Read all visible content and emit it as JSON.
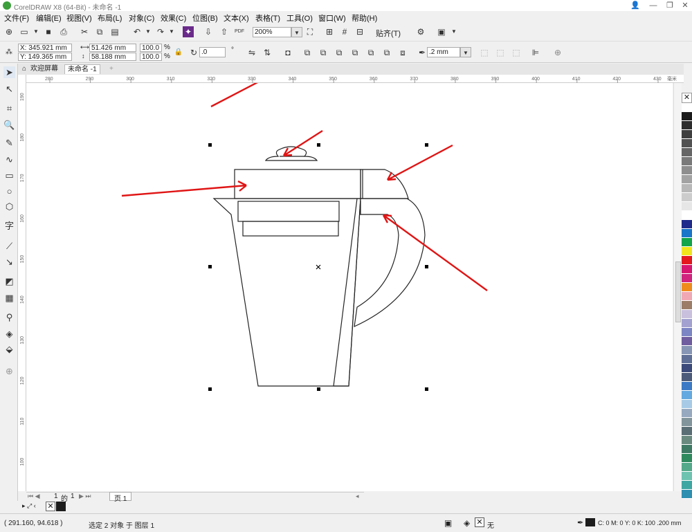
{
  "app": {
    "title": "CorelDRAW X8 (64-Bit) - 未命名 -1",
    "window_buttons": [
      "👤",
      "—",
      "❐",
      "✕"
    ]
  },
  "menu": [
    "文件(F)",
    "编辑(E)",
    "视图(V)",
    "布局(L)",
    "对象(C)",
    "效果(C)",
    "位图(B)",
    "文本(X)",
    "表格(T)",
    "工具(O)",
    "窗口(W)",
    "帮助(H)"
  ],
  "toolbar": {
    "zoom": "200%",
    "snap": "贴齐(T)",
    "pdf_label": "PDF"
  },
  "propbar": {
    "x": "X: 345.921 mm",
    "y": "Y: 149.365 mm",
    "w": "51.426 mm",
    "h": "58.188 mm",
    "sx": "100.0",
    "sy": "100.0",
    "pct1": "%",
    "pct2": "%",
    "angle": ".0",
    "degree": "°",
    "outline": ".2 mm"
  },
  "tabs": {
    "welcome": "欢迎屏幕",
    "doc": "未命名 -1",
    "add": "+"
  },
  "ruler": {
    "h": [
      "280",
      "290",
      "300",
      "310",
      "320",
      "330",
      "340",
      "350",
      "360",
      "370",
      "380",
      "390",
      "400",
      "410",
      "420",
      "430"
    ],
    "unit": "毫米",
    "v": [
      "190",
      "180",
      "170",
      "160",
      "150",
      "140",
      "130",
      "120",
      "110",
      "100"
    ]
  },
  "pagenav": {
    "current": "1",
    "of": "的",
    "total": "1",
    "page_tab": "页 1"
  },
  "status": {
    "coords": "( 291.160, 94.618 )",
    "selection": "选定 2 对象 于 图层 1",
    "fill_none": "无",
    "outline_info": "C: 0 M: 0 Y: 0 K: 100  .200 mm"
  },
  "palette_colors": [
    "#ffffff",
    "#1c1c1c",
    "#2d2d2d",
    "#3f3f3f",
    "#525252",
    "#666666",
    "#7a7a7a",
    "#8e8e8e",
    "#a3a3a3",
    "#b8b8b8",
    "#cccccc",
    "#e6e6e6",
    "#ffffff",
    "#1f2a8a",
    "#1b75c9",
    "#14a44a",
    "#f2e41c",
    "#e4171f",
    "#d71671",
    "#d0247f",
    "#ef8a1d",
    "#f1a8b5",
    "#9b7d68",
    "#c9c0dd",
    "#a3a1cf",
    "#7d86c4",
    "#6f5d9f",
    "#8796b5",
    "#5f6f96",
    "#3b4a7a",
    "#4d5b7a",
    "#3c7ac5",
    "#64a9df",
    "#a7cbe6",
    "#96a9bf",
    "#82959c",
    "#5a6e75",
    "#6a8a7f",
    "#3f7a65",
    "#2f8a5e",
    "#53a98a",
    "#6ec2b0",
    "#3fa7a2",
    "#2e8fb0"
  ]
}
